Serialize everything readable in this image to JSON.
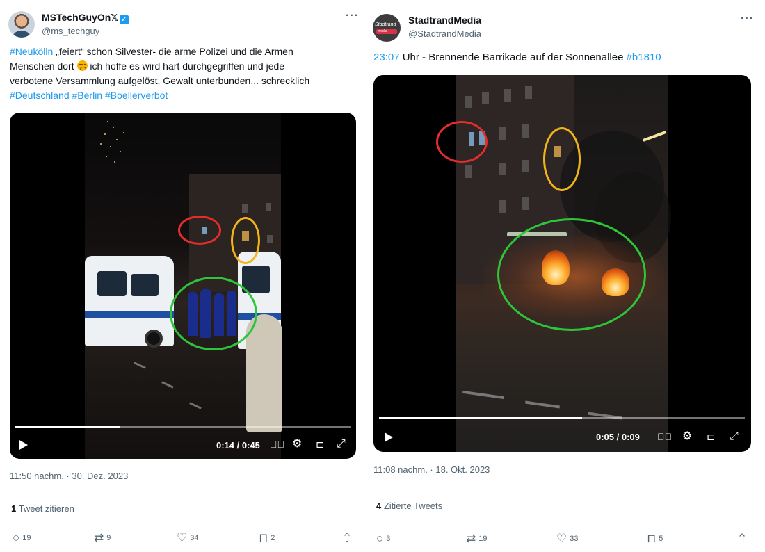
{
  "tweets": [
    {
      "author": {
        "name": "MSTechGuyOn",
        "name_suffix": "𝕏",
        "handle": "@ms_techguy",
        "verified": true
      },
      "text": {
        "tag1": "#Neukölln",
        "line1_rest": " „feiert“ schon Silvester- die arme Polizei und die Armen",
        "line2_a": "Menschen dort ",
        "line2_b": " ich hoffe es wird hart durchgegriffen und jede",
        "line3": "verbotene Versammlung aufgelöst, Gewalt unterbunden... schrecklich",
        "tag2": "#Deutschland",
        "tag3": "#Berlin",
        "tag4": "#Boellerverbot"
      },
      "video": {
        "time": "0:14 / 0:45",
        "progress": 0.311
      },
      "timestamp": "11:50 nachm. · 30. Dez. 2023",
      "quotes": {
        "count": "1",
        "label": "Tweet zitieren"
      },
      "actions": {
        "replies": "19",
        "retweets": "9",
        "likes": "34",
        "bookmarks": "2"
      }
    },
    {
      "author": {
        "name": "StadtrandMedia",
        "handle": "@StadtrandMedia",
        "verified": false,
        "avatar_text": "Stadtrand",
        "avatar_sub": "media"
      },
      "text": {
        "time_tag": "23:07",
        "body": " Uhr - Brennende Barrikade auf der Sonnenallee ",
        "tag": "#b1810"
      },
      "video": {
        "time": "0:05 / 0:09",
        "progress": 0.556
      },
      "timestamp": "11:08 nachm. · 18. Okt. 2023",
      "quotes": {
        "count": "4",
        "label": "Zitierte Tweets"
      },
      "actions": {
        "replies": "3",
        "retweets": "19",
        "likes": "33",
        "bookmarks": "5"
      }
    }
  ],
  "icons": {
    "more": "···",
    "reply": "◯",
    "retweet": "⇄",
    "like": "♡",
    "bookmark": "⎕",
    "share": "⇪",
    "volume": "🔊",
    "settings": "⚙",
    "fullscreen": "⤢"
  },
  "annotation_colors": {
    "red": "#e32c2c",
    "yellow": "#f2b41a",
    "green": "#2fc53b"
  }
}
